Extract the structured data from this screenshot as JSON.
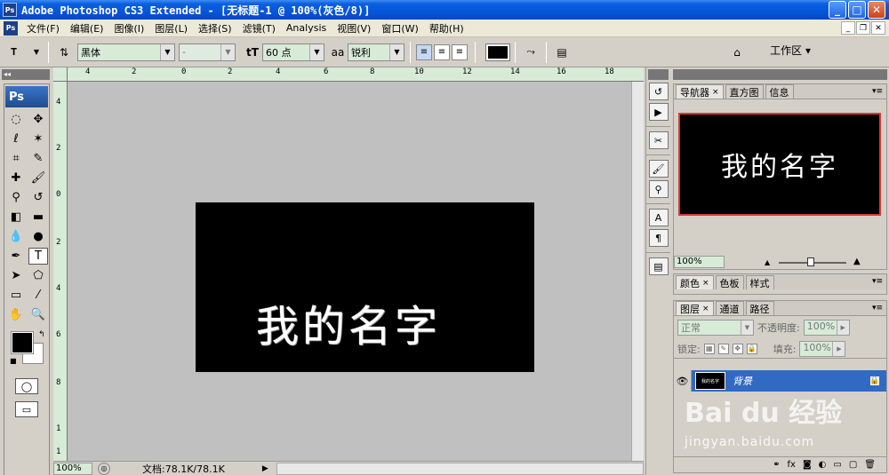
{
  "window": {
    "title": "Adobe Photoshop CS3 Extended - [无标题-1 @ 100%(灰色/8)]",
    "app_icon": "Ps",
    "min_label": "_",
    "max_label": "□",
    "close_label": "✕"
  },
  "menu": {
    "items": [
      "文件(F)",
      "编辑(E)",
      "图像(I)",
      "图层(L)",
      "选择(S)",
      "滤镜(T)",
      "Analysis",
      "视图(V)",
      "窗口(W)",
      "帮助(H)"
    ],
    "doc_min": "_",
    "doc_restore": "❐",
    "doc_close": "✕"
  },
  "options": {
    "font_family": "黑体",
    "font_style": "-",
    "font_size": "60 点",
    "antialias_prefix": "aa",
    "antialias": "锐利",
    "workspace_label": "工作区 ▾",
    "text_color": "#000000"
  },
  "toolbox": {
    "logo": "Ps"
  },
  "rulers": {
    "h_labels": [
      "4",
      "2",
      "0",
      "2",
      "4",
      "6",
      "8",
      "10",
      "12",
      "14",
      "16",
      "18"
    ],
    "v_labels": [
      "4",
      "2",
      "0",
      "2",
      "4",
      "6",
      "8",
      "1",
      "1"
    ]
  },
  "canvas": {
    "text": "我的名字",
    "background": "#000000",
    "text_color": "#ffffff"
  },
  "status": {
    "zoom": "100%",
    "doc_info": "文档:78.1K/78.1K"
  },
  "panels": {
    "navigator_tabs": [
      "导航器",
      "直方图",
      "信息"
    ],
    "navigator_zoom": "100%",
    "navigator_text": "我的名字",
    "color_tabs": [
      "颜色",
      "色板",
      "样式"
    ],
    "layers_tabs": [
      "图层",
      "通道",
      "路径"
    ],
    "blend_mode": "正常",
    "opacity_label": "不透明度:",
    "opacity_value": "100%",
    "lock_label": "锁定:",
    "fill_label": "填充:",
    "fill_value": "100%",
    "layer_name": "背景",
    "layer_thumb_text": "我的名字"
  },
  "watermark": {
    "text": "Bai du 经验",
    "sub": "jingyan.baidu.com"
  }
}
